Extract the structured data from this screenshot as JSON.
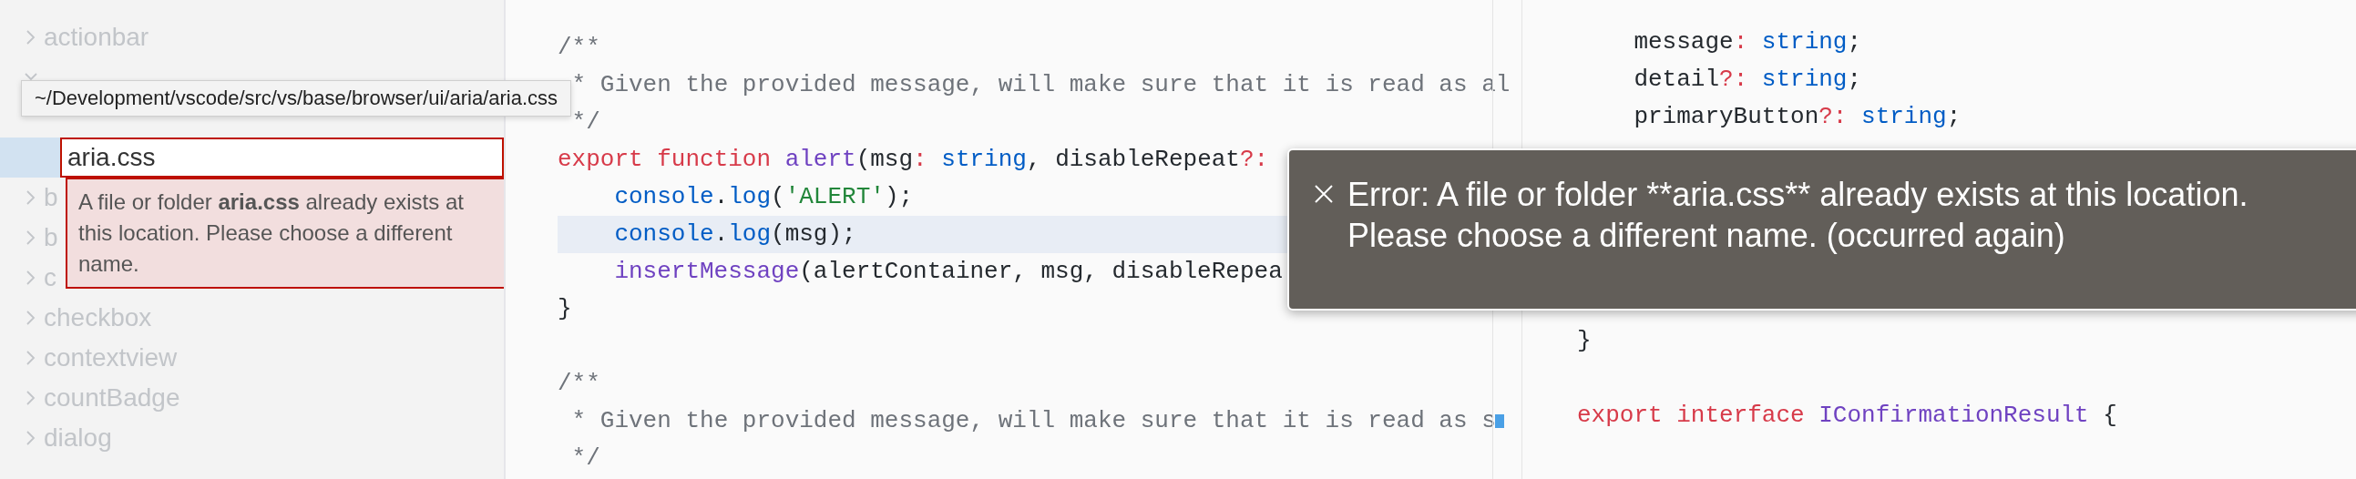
{
  "sidebar": {
    "tree": [
      {
        "label": "actionbar",
        "kind": "folder",
        "expanded": false,
        "selected": false
      },
      {
        "kind": "folder",
        "expanded": true,
        "selected": false,
        "children": [
          {
            "kind": "file",
            "selected": false
          },
          {
            "kind": "rename",
            "value": "aria.css",
            "selected": true,
            "error": "A file or folder **aria.css** already exists at this location. Please choose a different name."
          }
        ]
      },
      {
        "label": "b",
        "kind": "folder",
        "expanded": false,
        "selected": false
      },
      {
        "label": "b",
        "kind": "folder",
        "expanded": false,
        "selected": false
      },
      {
        "label": "c",
        "kind": "folder",
        "expanded": false,
        "selected": false
      },
      {
        "label": "checkbox",
        "kind": "folder",
        "expanded": false,
        "selected": false
      },
      {
        "label": "contextview",
        "kind": "folder",
        "expanded": false,
        "selected": false
      },
      {
        "label": "countBadge",
        "kind": "folder",
        "expanded": false,
        "selected": false
      },
      {
        "label": "dialog",
        "kind": "folder",
        "expanded": false,
        "selected": false
      }
    ],
    "tooltip": "~/Development/vscode/src/vs/base/browser/ui/aria/aria.css"
  },
  "left_editor": {
    "blocks": [
      {
        "lines": [
          {
            "tokens": [
              {
                "kind": "comment",
                "s": "/**"
              }
            ]
          },
          {
            "tokens": [
              {
                "kind": "comment",
                "s": " * Given the provided message, will make sure that it is read as al"
              }
            ]
          },
          {
            "tokens": [
              {
                "kind": "comment",
                "s": " */"
              }
            ]
          },
          {
            "tokens": [
              {
                "kind": "keyword",
                "s": "export function "
              },
              {
                "kind": "func",
                "s": "alert"
              },
              {
                "kind": "plain",
                "s": "(msg"
              },
              {
                "kind": "op",
                "s": ": "
              },
              {
                "kind": "type",
                "s": "string"
              },
              {
                "kind": "plain",
                "s": ", disableRepeat"
              },
              {
                "kind": "op",
                "s": "?:"
              }
            ]
          },
          {
            "indented": true,
            "tokens": [
              {
                "kind": "type",
                "s": "console"
              },
              {
                "kind": "plain",
                "s": "."
              },
              {
                "kind": "type",
                "s": "log"
              },
              {
                "kind": "plain",
                "s": "("
              },
              {
                "kind": "string",
                "s": "'ALERT'"
              },
              {
                "kind": "plain",
                "s": ");"
              }
            ]
          },
          {
            "indented": true,
            "highlighted": true,
            "tokens": [
              {
                "kind": "type",
                "s": "console"
              },
              {
                "kind": "plain",
                "s": "."
              },
              {
                "kind": "type",
                "s": "log"
              },
              {
                "kind": "plain",
                "s": "(msg);"
              }
            ]
          },
          {
            "indented": true,
            "tokens": [
              {
                "kind": "func",
                "s": "insertMessage"
              },
              {
                "kind": "plain",
                "s": "(alertContainer, msg, disableRepea"
              }
            ]
          },
          {
            "tokens": [
              {
                "kind": "plain",
                "s": "}"
              }
            ]
          }
        ]
      },
      {
        "lines": [
          {
            "tokens": [
              {
                "kind": "comment",
                "s": "/**"
              }
            ]
          },
          {
            "tokens": [
              {
                "kind": "comment",
                "s": " * Given the provided message, will make sure that it is read as s"
              }
            ]
          },
          {
            "tokens": [
              {
                "kind": "comment",
                "s": " */"
              }
            ]
          }
        ]
      }
    ]
  },
  "right_editor": {
    "blocks": [
      {
        "lines": [
          {
            "indented": true,
            "tokens": [
              {
                "kind": "plain",
                "s": "message"
              },
              {
                "kind": "op",
                "s": ": "
              },
              {
                "kind": "type",
                "s": "string"
              },
              {
                "kind": "plain",
                "s": ";"
              }
            ]
          },
          {
            "indented": true,
            "tokens": [
              {
                "kind": "plain",
                "s": "detail"
              },
              {
                "kind": "op",
                "s": "?: "
              },
              {
                "kind": "type",
                "s": "string"
              },
              {
                "kind": "plain",
                "s": ";"
              }
            ]
          },
          {
            "indented": true,
            "tokens": [
              {
                "kind": "plain",
                "s": "primaryButton"
              },
              {
                "kind": "op",
                "s": "?: "
              },
              {
                "kind": "type",
                "s": "string"
              },
              {
                "kind": "plain",
                "s": ";"
              }
            ]
          }
        ]
      },
      {
        "lines": [
          {
            "tokens": [
              {
                "kind": "plain",
                "s": "}"
              }
            ]
          }
        ]
      },
      {
        "lines": [
          {
            "tokens": [
              {
                "kind": "keyword",
                "s": "export interface "
              },
              {
                "kind": "func",
                "s": "IConfirmationResult"
              },
              {
                "kind": "plain",
                "s": " {"
              }
            ]
          }
        ]
      }
    ]
  },
  "notification": {
    "message": "Error: A file or folder **aria.css** already exists at this location. Please choose a different name. (occurred again)"
  }
}
